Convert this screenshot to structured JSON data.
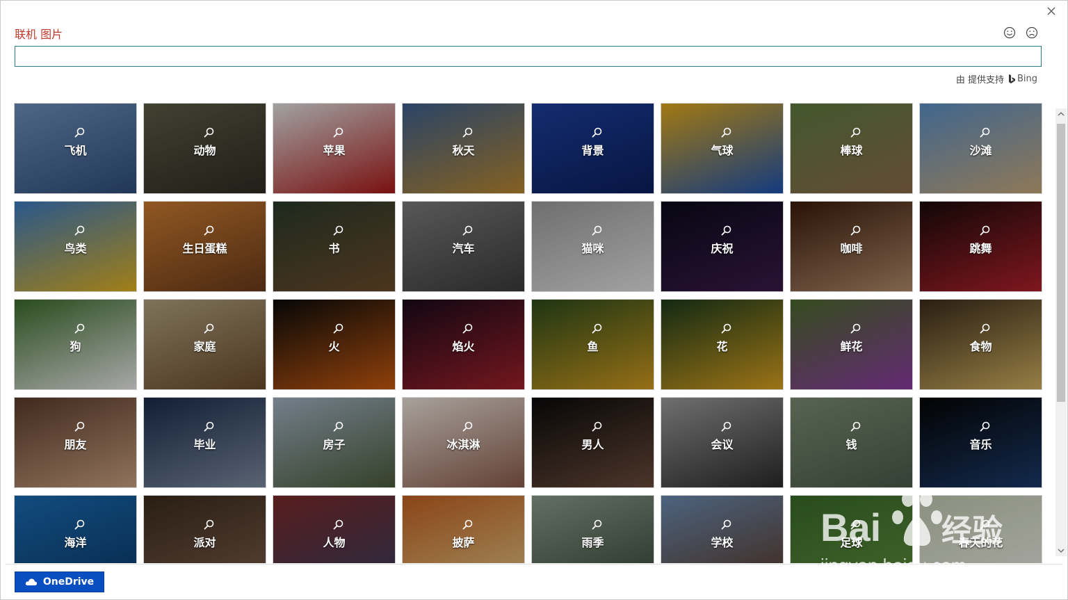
{
  "dialog": {
    "title": "联机 图片",
    "close_icon": "close-icon"
  },
  "feedback": {
    "happy_icon": "smiley-icon",
    "sad_icon": "frown-icon"
  },
  "search": {
    "value": "",
    "placeholder": ""
  },
  "credit": {
    "text": "由 提供支持",
    "brand": "Bing"
  },
  "tiles": [
    {
      "label": "飞机",
      "c1": "#6c8fb8",
      "c2": "#2f4d7a"
    },
    {
      "label": "动物",
      "c1": "#5b5a45",
      "c2": "#2e2b22"
    },
    {
      "label": "苹果",
      "c1": "#e0e0e0",
      "c2": "#a81818"
    },
    {
      "label": "秋天",
      "c1": "#3b5f8e",
      "c2": "#b8862e"
    },
    {
      "label": "背景",
      "c1": "#1c3e9a",
      "c2": "#0a1e5c"
    },
    {
      "label": "气球",
      "c1": "#e0a81a",
      "c2": "#1c52b0"
    },
    {
      "label": "棒球",
      "c1": "#5d7a40",
      "c2": "#8b6a4a"
    },
    {
      "label": "沙滩",
      "c1": "#5a8ec4",
      "c2": "#c6a77a"
    },
    {
      "label": "鸟类",
      "c1": "#3a7ac0",
      "c2": "#e0b020"
    },
    {
      "label": "生日蛋糕",
      "c1": "#c87a30",
      "c2": "#6a3a1a"
    },
    {
      "label": "书",
      "c1": "#2a3a2a",
      "c2": "#6a4a2a"
    },
    {
      "label": "汽车",
      "c1": "#7a7a7a",
      "c2": "#3a3a3a"
    },
    {
      "label": "猫咪",
      "c1": "#9a9a9a",
      "c2": "#e0e0e0"
    },
    {
      "label": "庆祝",
      "c1": "#0a0a1a",
      "c2": "#3a1a4a"
    },
    {
      "label": "咖啡",
      "c1": "#3a1a0a",
      "c2": "#b08a6a"
    },
    {
      "label": "跳舞",
      "c1": "#1a0a0a",
      "c2": "#b0202a"
    },
    {
      "label": "狗",
      "c1": "#3a6a2a",
      "c2": "#e8e8e8"
    },
    {
      "label": "家庭",
      "c1": "#b0a080",
      "c2": "#6a4a2a"
    },
    {
      "label": "火",
      "c1": "#0a0a0a",
      "c2": "#c85a10"
    },
    {
      "label": "焰火",
      "c1": "#1a0a1a",
      "c2": "#a0202a"
    },
    {
      "label": "鱼",
      "c1": "#2a4a1a",
      "c2": "#d09a20"
    },
    {
      "label": "花",
      "c1": "#1a3a1a",
      "c2": "#d8a020"
    },
    {
      "label": "鲜花",
      "c1": "#4a6a2a",
      "c2": "#8a3aa0"
    },
    {
      "label": "食物",
      "c1": "#3a2a1a",
      "c2": "#d0b060"
    },
    {
      "label": "朋友",
      "c1": "#5a3a2a",
      "c2": "#c8a080"
    },
    {
      "label": "毕业",
      "c1": "#1a2a4a",
      "c2": "#7a8aa0"
    },
    {
      "label": "房子",
      "c1": "#a0b0c0",
      "c2": "#4a5a3a"
    },
    {
      "label": "冰淇淋",
      "c1": "#e8e0d8",
      "c2": "#8a5a4a"
    },
    {
      "label": "男人",
      "c1": "#0a0a0a",
      "c2": "#6a4a3a"
    },
    {
      "label": "会议",
      "c1": "#9a9a9a",
      "c2": "#2a2a2a"
    },
    {
      "label": "钱",
      "c1": "#7a8a70",
      "c2": "#4a5a4a"
    },
    {
      "label": "音乐",
      "c1": "#050505",
      "c2": "#1a3a6a"
    },
    {
      "label": "海洋",
      "c1": "#1a6ab0",
      "c2": "#0a3a6a"
    },
    {
      "label": "派对",
      "c1": "#3a2a1a",
      "c2": "#7a5a4a"
    },
    {
      "label": "人物",
      "c1": "#7a2a2a",
      "c2": "#3a3a5a"
    },
    {
      "label": "披萨",
      "c1": "#c06020",
      "c2": "#e0c080"
    },
    {
      "label": "雨季",
      "c1": "#8a9a8a",
      "c2": "#3a4a3a"
    },
    {
      "label": "学校",
      "c1": "#6a8ab0",
      "c2": "#5a3a2a"
    },
    {
      "label": "足球",
      "c1": "#3a6a2a",
      "c2": "#5a8a3a"
    },
    {
      "label": "春天的花",
      "c1": "#c0c8b0",
      "c2": "#e8e8e0"
    }
  ],
  "footer": {
    "onedrive_label": "OneDrive"
  },
  "watermark": {
    "brand": "Bai",
    "brand_suffix": "经验",
    "url": "jingyan.baidu.com"
  }
}
